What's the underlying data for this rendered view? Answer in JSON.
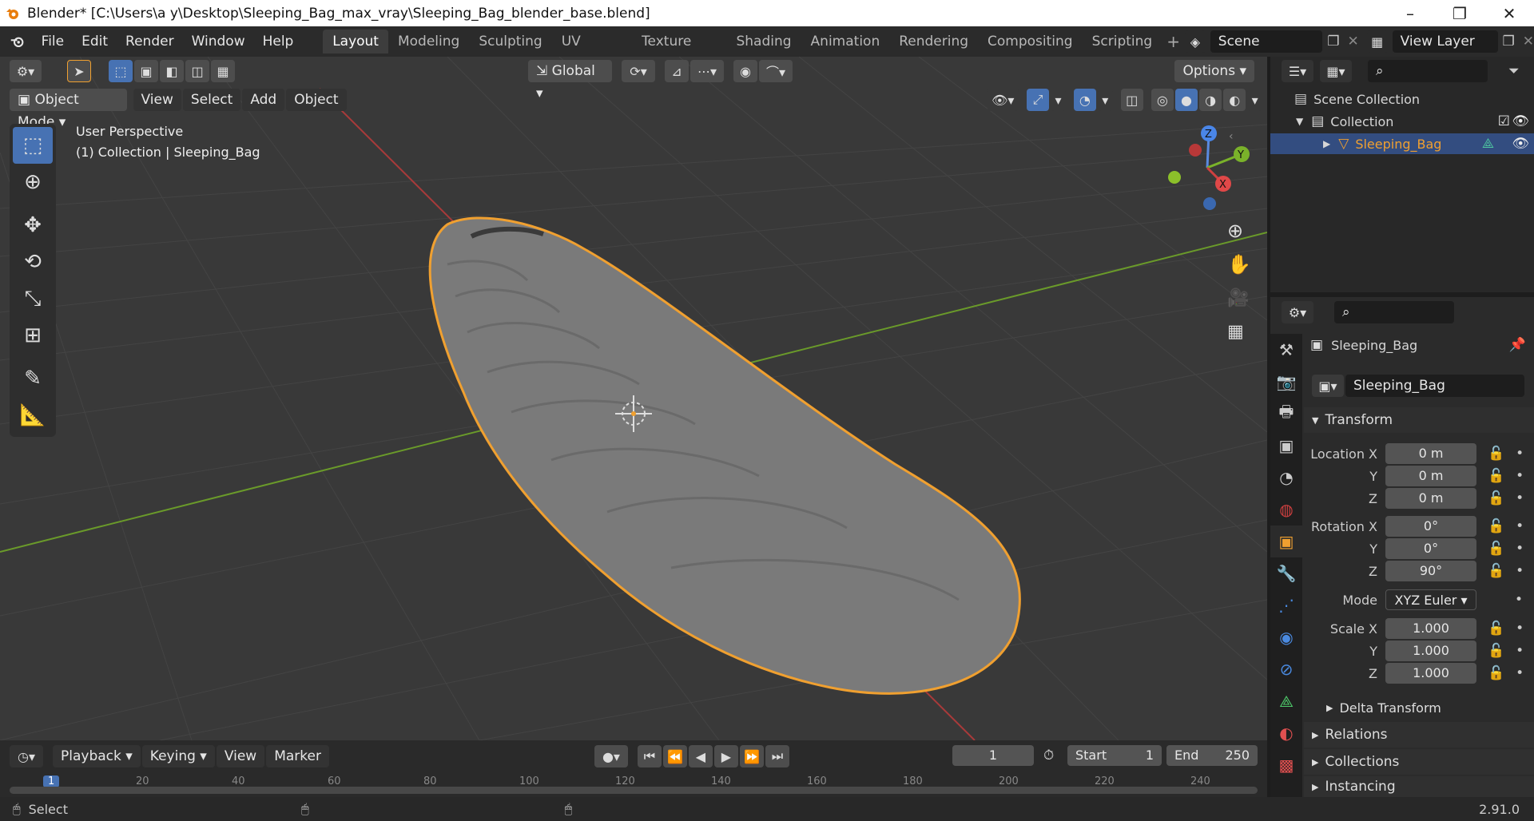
{
  "window": {
    "title": "Blender* [C:\\Users\\a y\\Desktop\\Sleeping_Bag_max_vray\\Sleeping_Bag_blender_base.blend]",
    "minimize": "–",
    "maximize": "❐",
    "close": "✕"
  },
  "menus": [
    "File",
    "Edit",
    "Render",
    "Window",
    "Help"
  ],
  "workspaces": [
    "Layout",
    "Modeling",
    "Sculpting",
    "UV Editing",
    "Texture Paint",
    "Shading",
    "Animation",
    "Rendering",
    "Compositing",
    "Scripting"
  ],
  "scene": {
    "name": "Scene",
    "view_layer": "View Layer"
  },
  "header": {
    "transform_orientation": "Global",
    "options": "Options"
  },
  "viewport": {
    "mode": "Object Mode",
    "menus": [
      "View",
      "Select",
      "Add",
      "Object"
    ],
    "overlay_line1": "User Perspective",
    "overlay_line2": "(1) Collection | Sleeping_Bag",
    "gizmo": {
      "z": "Z",
      "y": "Y",
      "x": "X"
    },
    "colors": {
      "bg": "#393939",
      "grid": "#444444",
      "xaxis": "#a83a3a",
      "yaxis": "#6a9a2a",
      "outline": "#f0a030",
      "mesh": "#7a7a7a"
    }
  },
  "outliner": {
    "scene_collection": "Scene Collection",
    "collection": "Collection",
    "object": "Sleeping_Bag"
  },
  "properties": {
    "object_name": "Sleeping_Bag",
    "datablock": "Sleeping_Bag",
    "transform_label": "Transform",
    "location": {
      "label": "Location X",
      "x": "0 m",
      "y": "0 m",
      "z": "0 m"
    },
    "rotation": {
      "label": "Rotation X",
      "x": "0°",
      "y": "0°",
      "z": "90°"
    },
    "mode_label": "Mode",
    "mode_value": "XYZ Euler",
    "scale": {
      "label": "Scale X",
      "x": "1.000",
      "y": "1.000",
      "z": "1.000"
    },
    "axis_y": "Y",
    "axis_z": "Z",
    "delta_transform": "Delta Transform",
    "relations": "Relations",
    "collections": "Collections",
    "instancing": "Instancing"
  },
  "timeline": {
    "menus": [
      "Playback",
      "Keying",
      "View",
      "Marker"
    ],
    "current_frame": "1",
    "start_label": "Start",
    "start": "1",
    "end_label": "End",
    "end": "250",
    "ticks": [
      "1",
      "20",
      "40",
      "60",
      "80",
      "100",
      "120",
      "140",
      "160",
      "180",
      "200",
      "220",
      "240"
    ]
  },
  "status": {
    "select": "Select",
    "version": "2.91.0"
  }
}
